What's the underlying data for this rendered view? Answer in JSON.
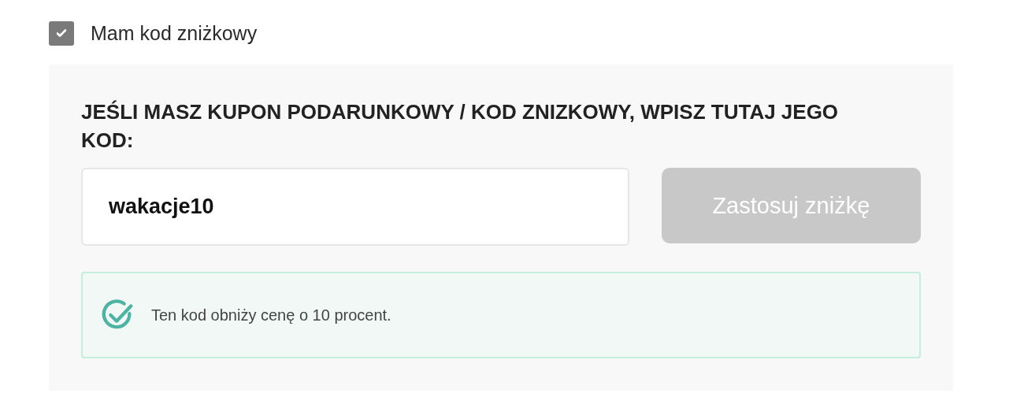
{
  "discount_checkbox": {
    "label": "Mam kod zniżkowy",
    "checked": true
  },
  "coupon_panel": {
    "heading": "JEŚLI MASZ KUPON PODARUNKOWY / KOD ZNIZKOWY, WPISZ TUTAJ JEGO KOD:",
    "code_field": {
      "value": "wakacje10"
    },
    "apply_button": {
      "label": "Zastosuj zniżkę",
      "disabled": true
    },
    "message": {
      "kind": "success",
      "text": "Ten kod obniży cenę o 10 procent."
    }
  }
}
